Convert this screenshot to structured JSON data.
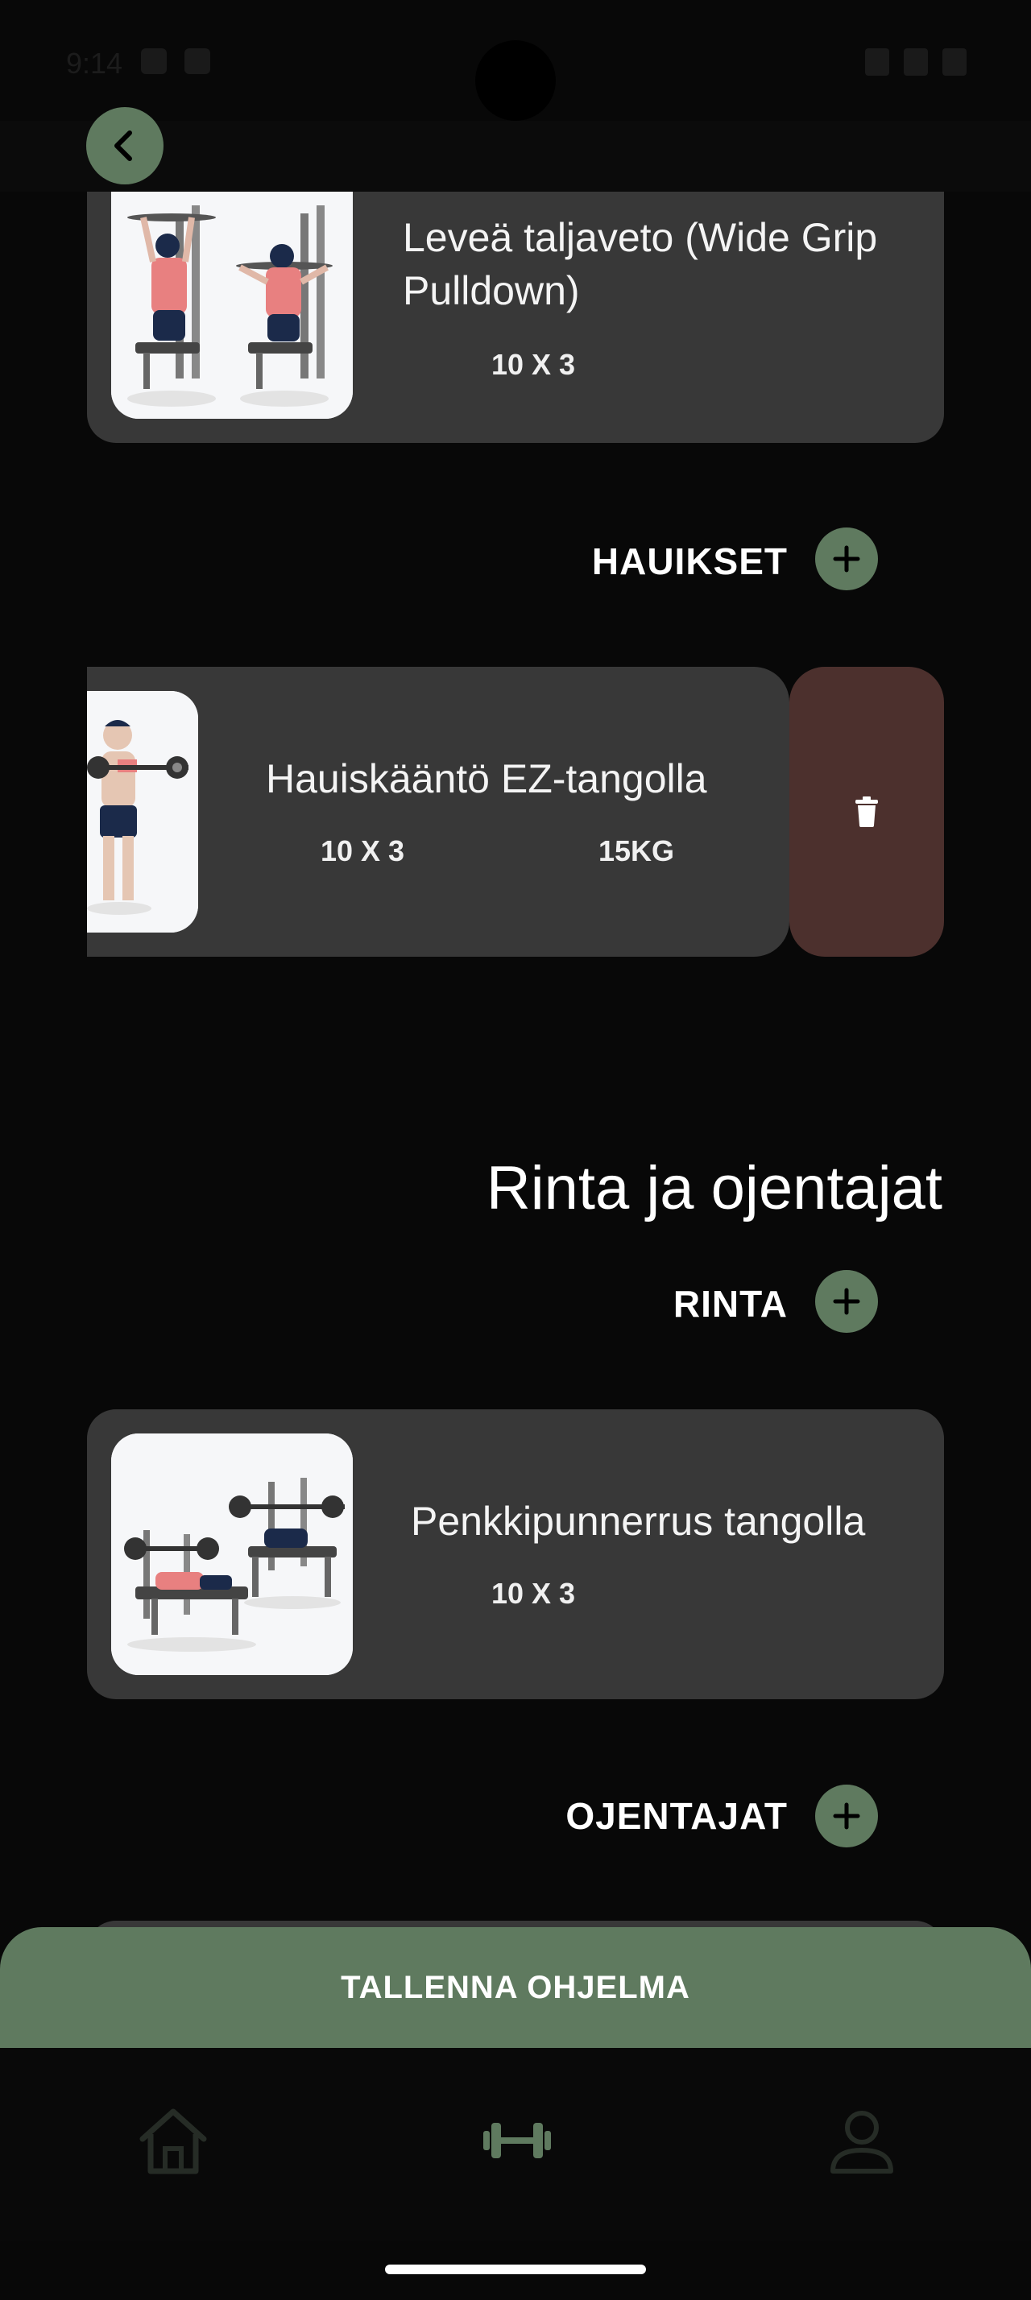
{
  "status_bar": {
    "time": "9:14"
  },
  "top_bar": {
    "back_icon": "chevron-left-icon"
  },
  "exercises": {
    "wide_grip": {
      "name": "Leveä taljaveto (Wide Grip Pulldown)",
      "sets": "10 X 3"
    },
    "ez_curl": {
      "name": "Hauiskääntö EZ-tangolla",
      "sets": "10 X 3",
      "weight": "15KG"
    },
    "bench": {
      "name": "Penkkipunnerrus tangolla",
      "sets": "10 X 3"
    }
  },
  "sections": {
    "hauikset": "HAUIKSET",
    "rinta": "RINTA",
    "ojentajat": "OJENTAJAT"
  },
  "group_title": "Rinta ja ojentajat",
  "actions": {
    "save": "TALLENNA OHJELMA",
    "delete_icon": "trash-icon",
    "add_icon": "plus-icon"
  },
  "bottom_nav": {
    "items": [
      {
        "icon": "home-icon",
        "active": false
      },
      {
        "icon": "dumbbell-icon",
        "active": true
      },
      {
        "icon": "profile-icon",
        "active": false
      }
    ]
  },
  "colors": {
    "background": "#080808",
    "card": "#383838",
    "accent": "#5f7a5f",
    "delete": "#4c302d"
  }
}
